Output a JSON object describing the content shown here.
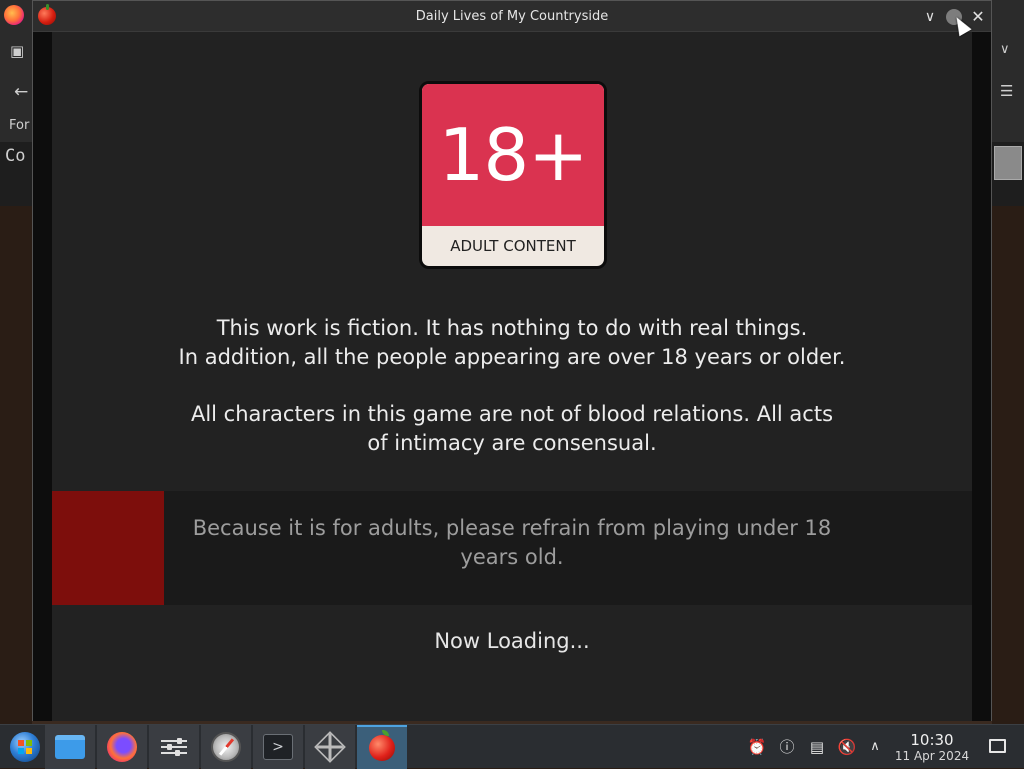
{
  "background_browser": {
    "left_labels": [
      "For",
      "Co"
    ],
    "left_icons": [
      "archive-icon",
      "back-arrow-icon"
    ],
    "right_icons": [
      "chevron-down-icon",
      "hamburger-menu-icon"
    ]
  },
  "window": {
    "title": "Daily Lives of My Countryside",
    "controls": {
      "minimize": "∨",
      "maximize": "",
      "close": "✕"
    }
  },
  "game": {
    "badge": {
      "rating": "18+",
      "label": "ADULT CONTENT",
      "color": "#da3350"
    },
    "notice_lines_1": [
      "This work is fiction. It has nothing to do with real things.",
      "In addition, all the people appearing are over 18 years or older."
    ],
    "notice_lines_2": [
      "All characters in this game are not of blood relations. All acts",
      "of intimacy are consensual."
    ],
    "warning_lines": [
      "Because it is for adults, please refrain from playing under 18",
      "years old."
    ],
    "warning_accent": "#7d0e0c",
    "loading": "Now Loading..."
  },
  "taskbar": {
    "items": [
      {
        "name": "start-menu",
        "icon": "start-orb-icon"
      },
      {
        "name": "file-manager",
        "icon": "folder-icon"
      },
      {
        "name": "firefox",
        "icon": "firefox-icon"
      },
      {
        "name": "settings",
        "icon": "settings-sliders-icon"
      },
      {
        "name": "safari",
        "icon": "compass-icon"
      },
      {
        "name": "terminal",
        "icon": "terminal-icon"
      },
      {
        "name": "3d-app",
        "icon": "cube-icon"
      },
      {
        "name": "game-app",
        "icon": "apple-icon",
        "active": true
      }
    ],
    "tray": [
      "notifications-icon",
      "network-icon",
      "clipboard-icon",
      "muted-speaker-icon",
      "chevron-up-icon"
    ],
    "clock": {
      "time": "10:30",
      "date": "11 Apr 2024"
    }
  }
}
